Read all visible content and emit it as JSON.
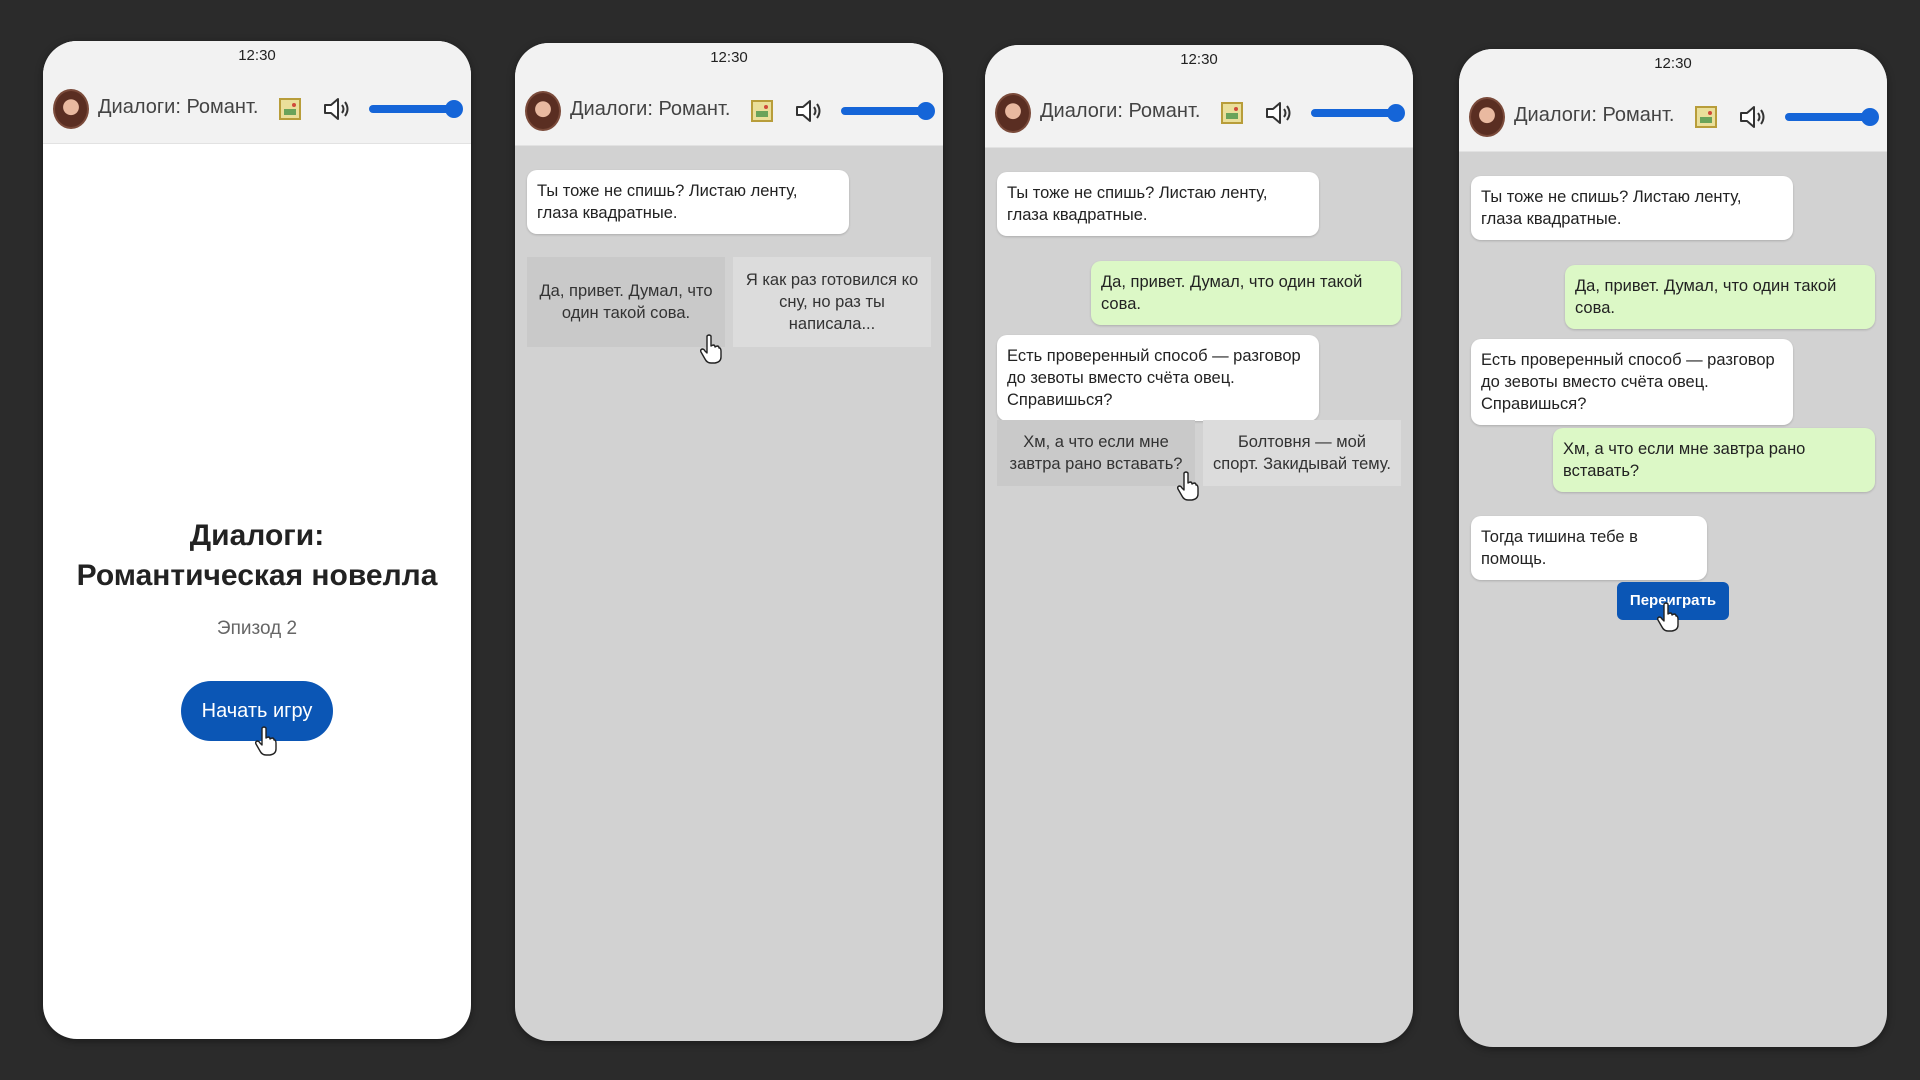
{
  "time": "12:30",
  "header_title": "Диалоги: Романт...",
  "icons": {
    "avatar": "avatar",
    "image": "image-icon",
    "sound": "speaker-icon",
    "cursor": "hand-cursor-icon"
  },
  "volume_level": 1.0,
  "accent_color": "#0b56b5",
  "start": {
    "title": "Диалоги: Романтическая новелла",
    "episode": "Эпизод 2",
    "start_button": "Начать игру"
  },
  "messages": {
    "m1": "Ты тоже не спишь? Листаю ленту, глаза квадратные.",
    "m2": "Да, привет. Думал, что один такой сова.",
    "m3": "Есть проверенный способ — разговор до зевоты вместо счёта овец. Справишься?",
    "m4": "Хм, а что если мне завтра рано вставать?",
    "m5": "Тогда тишина тебе в помощь."
  },
  "choices_1": [
    "Да, привет. Думал, что один такой сова.",
    "Я как раз готовился ко сну, но раз ты написала..."
  ],
  "choices_2": [
    "Хм, а что если мне завтра рано вставать?",
    "Болтовня — мой спорт. Закидывай тему."
  ],
  "replay_button": "Переиграть"
}
